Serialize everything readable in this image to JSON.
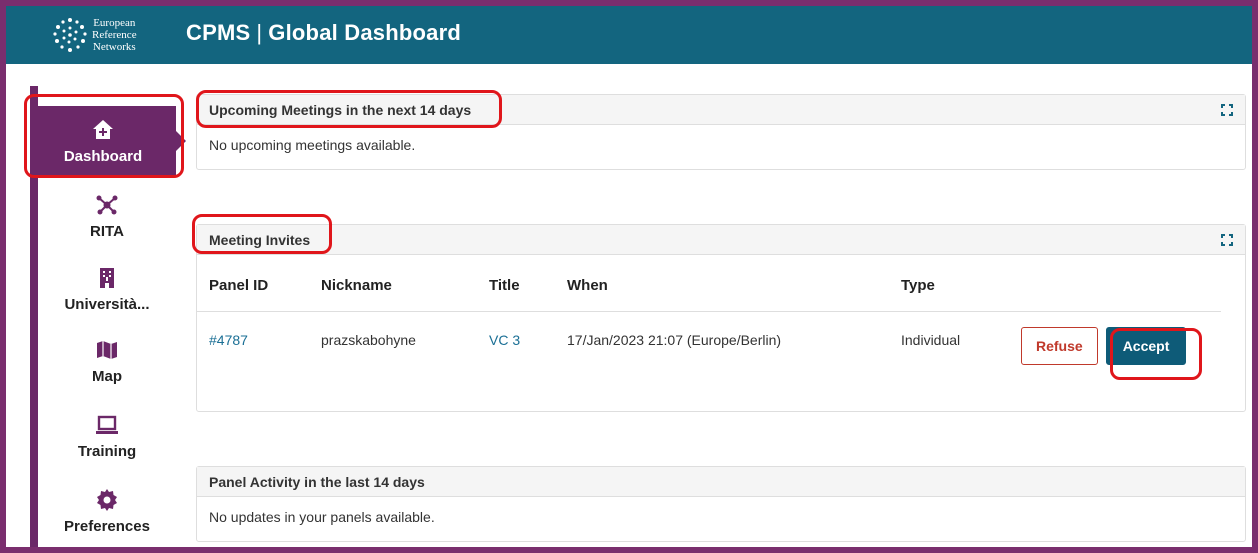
{
  "header": {
    "logo_lines": [
      "European",
      "Reference",
      "Networks"
    ],
    "app_name": "CPMS",
    "separator": "|",
    "page_name": "Global Dashboard"
  },
  "sidebar": {
    "items": [
      {
        "label": "Dashboard",
        "icon": "home-icon",
        "active": true
      },
      {
        "label": "RITA",
        "icon": "network-icon",
        "active": false
      },
      {
        "label": "Università...",
        "icon": "building-icon",
        "active": false
      },
      {
        "label": "Map",
        "icon": "map-icon",
        "active": false
      },
      {
        "label": "Training",
        "icon": "laptop-icon",
        "active": false
      },
      {
        "label": "Preferences",
        "icon": "gear-icon",
        "active": false
      }
    ]
  },
  "upcoming": {
    "title": "Upcoming Meetings in the next 14 days",
    "empty_text": "No upcoming meetings available."
  },
  "invites": {
    "title": "Meeting Invites",
    "columns": [
      "Panel ID",
      "Nickname",
      "Title",
      "When",
      "Type"
    ],
    "rows": [
      {
        "panel_id": "#4787",
        "nickname": "prazskabohyne",
        "title": "VC 3",
        "when": "17/Jan/2023 21:07 (Europe/Berlin)",
        "type": "Individual"
      }
    ],
    "refuse_label": "Refuse",
    "accept_label": "Accept"
  },
  "activity": {
    "title": "Panel Activity in the last 14 days",
    "empty_text": "No updates in your panels available."
  },
  "colors": {
    "topbar": "#13657f",
    "sidebar_accent": "#6b2868",
    "accept": "#0e5b78",
    "refuse": "#c0392b",
    "highlight": "#e0161b"
  }
}
